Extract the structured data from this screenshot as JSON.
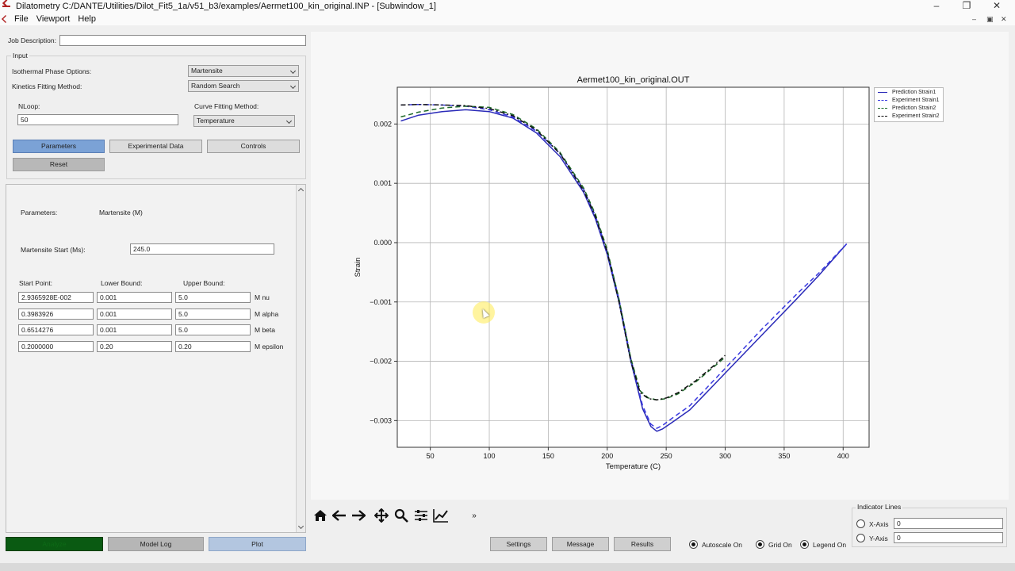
{
  "window": {
    "title": "Dilatometry C:/DANTE/Utilities/Dilot_Fit5_1a/v51_b3/examples/Aermet100_kin_original.INP - [Subwindow_1]",
    "min": "–",
    "max": "❐",
    "close": "✕"
  },
  "menu": {
    "file": "File",
    "viewport": "Viewport",
    "help": "Help",
    "mdi_min": "–",
    "mdi_restore": "▣",
    "mdi_close": "✕"
  },
  "form": {
    "job_description_label": "Job Description:",
    "job_description_value": "",
    "input_group": "Input",
    "isothermal_label": "Isothermal Phase Options:",
    "isothermal_value": "Martensite",
    "kinetics_label": "Kinetics Fitting Method:",
    "kinetics_value": "Random Search",
    "nloop_label": "NLoop:",
    "nloop_value": "50",
    "curve_label": "Curve Fitting Method:",
    "curve_value": "Temperature",
    "btn_parameters": "Parameters",
    "btn_experimental": "Experimental Data",
    "btn_controls": "Controls",
    "btn_reset": "Reset"
  },
  "params": {
    "parameters_label": "Parameters:",
    "parameters_value": "Martensite (M)",
    "ms_label": "Martensite Start (Ms):",
    "ms_value": "245.0",
    "col_start": "Start Point:",
    "col_lower": "Lower Bound:",
    "col_upper": "Upper Bound:",
    "rows": [
      {
        "start": "2.9365928E-002",
        "lower": "0.001",
        "upper": "5.0",
        "name": "M nu"
      },
      {
        "start": "0.3983926",
        "lower": "0.001",
        "upper": "5.0",
        "name": "M alpha"
      },
      {
        "start": "0.6514276",
        "lower": "0.001",
        "upper": "5.0",
        "name": "M beta"
      },
      {
        "start": "0.2000000",
        "lower": "0.20",
        "upper": "0.20",
        "name": "M epsilon"
      }
    ]
  },
  "bottom": {
    "analyze": "Analyze",
    "model_log": "Model Log",
    "plot": "Plot",
    "settings": "Settings",
    "message": "Message",
    "results": "Results",
    "autoscale": "Autoscale On",
    "grid": "Grid On",
    "legend": "Legend On",
    "indicator_title": "Indicator Lines",
    "x_axis": "X-Axis",
    "x_axis_value": "0",
    "y_axis": "Y-Axis",
    "y_axis_value": "0"
  },
  "toolbar": {
    "more": "»"
  },
  "chart_data": {
    "type": "line",
    "title": "Aermet100_kin_original.OUT",
    "xlabel": "Temperature (C)",
    "ylabel": "Strain",
    "xlim": [
      22,
      422
    ],
    "ylim": [
      -0.00345,
      0.00262
    ],
    "xticks": [
      50,
      100,
      150,
      200,
      250,
      300,
      350,
      400
    ],
    "yticks": [
      -0.003,
      -0.002,
      -0.001,
      0.0,
      0.001,
      0.002
    ],
    "ytick_labels": [
      "−0.003",
      "−0.002",
      "−0.001",
      "0.000",
      "0.001",
      "0.002"
    ],
    "grid": true,
    "legend_position": "outside-right",
    "series": [
      {
        "name": "Prediction Strain1",
        "color": "#2a2ab8",
        "dash": "solid",
        "x": [
          25,
          40,
          60,
          80,
          100,
          120,
          140,
          160,
          180,
          190,
          200,
          210,
          220,
          230,
          237,
          242,
          247,
          255,
          270,
          300,
          330,
          360,
          380,
          403
        ],
        "y": [
          0.00205,
          0.00215,
          0.00221,
          0.00224,
          0.00221,
          0.0021,
          0.00185,
          0.00145,
          0.00085,
          0.0004,
          -0.0002,
          -0.001,
          -0.002,
          -0.0028,
          -0.0031,
          -0.00318,
          -0.00314,
          -0.00303,
          -0.00282,
          -0.0022,
          -0.00158,
          -0.00096,
          -0.00054,
          -2e-05
        ]
      },
      {
        "name": "Experiment Strain1",
        "color": "#3a3ae0",
        "dash": "6,4",
        "x": [
          25,
          40,
          60,
          80,
          100,
          120,
          140,
          160,
          180,
          190,
          200,
          210,
          220,
          230,
          237,
          242,
          247,
          255,
          270,
          300,
          330,
          360,
          380,
          403
        ],
        "y": [
          0.00232,
          0.00233,
          0.00232,
          0.0023,
          0.00224,
          0.00212,
          0.00188,
          0.0015,
          0.0009,
          0.00045,
          -0.00015,
          -0.00095,
          -0.00195,
          -0.00275,
          -0.00306,
          -0.00313,
          -0.00308,
          -0.00296,
          -0.00275,
          -0.00212,
          -0.00148,
          -0.00088,
          -0.0005,
          -2e-05
        ]
      },
      {
        "name": "Prediction Strain2",
        "color": "#1f6a2a",
        "dash": "6,4",
        "x": [
          25,
          40,
          60,
          80,
          100,
          120,
          140,
          160,
          180,
          190,
          200,
          210,
          220,
          228,
          235,
          242,
          250,
          260,
          275,
          290,
          300
        ],
        "y": [
          0.00212,
          0.0022,
          0.00227,
          0.0023,
          0.00228,
          0.00216,
          0.00192,
          0.00152,
          0.00092,
          0.00048,
          -0.00012,
          -0.00095,
          -0.00195,
          -0.0025,
          -0.00262,
          -0.00265,
          -0.00263,
          -0.00255,
          -0.00235,
          -0.0021,
          -0.00193
        ]
      },
      {
        "name": "Experiment Strain2",
        "color": "#111111",
        "dash": "6,3,2,3",
        "x": [
          25,
          40,
          60,
          80,
          100,
          120,
          140,
          160,
          180,
          190,
          200,
          210,
          220,
          228,
          235,
          242,
          250,
          260,
          275,
          290,
          300
        ],
        "y": [
          0.00232,
          0.00233,
          0.00232,
          0.00231,
          0.00226,
          0.00214,
          0.0019,
          0.0015,
          0.00088,
          0.00044,
          -0.00016,
          -0.001,
          -0.002,
          -0.00253,
          -0.00263,
          -0.00265,
          -0.00262,
          -0.00253,
          -0.00233,
          -0.00208,
          -0.0019
        ]
      }
    ]
  }
}
